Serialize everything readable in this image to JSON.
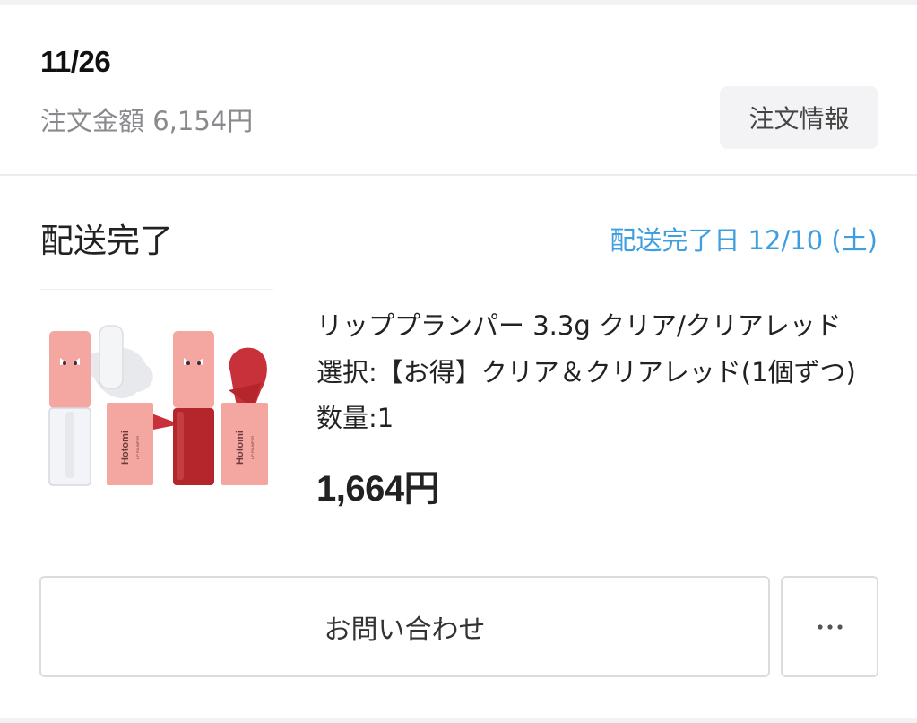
{
  "order": {
    "date": "11/26",
    "total_label": "注文金額 6,154円",
    "info_button_label": "注文情報"
  },
  "delivery": {
    "status": "配送完了",
    "completed_date": "配送完了日 12/10 (土)"
  },
  "item": {
    "name": "リッププランパー 3.3g クリア/クリアレッド",
    "option": "選択:【お得】クリア＆クリアレッド(1個ずつ)",
    "quantity": "数量:1",
    "price": "1,664円",
    "image": {
      "brand_text": "Hotomi",
      "sub_text": "LIP PLUMPER",
      "colors": {
        "cap": "#f4a7a0",
        "clear_liquid": "#f2f4f7",
        "red_liquid": "#b5262c"
      }
    }
  },
  "actions": {
    "contact_label": "お問い合わせ",
    "more_icon": "ellipsis-icon"
  },
  "colors": {
    "accent_blue": "#3d9ee0",
    "muted_text": "#8a8a8e",
    "button_bg": "#f3f3f5",
    "border": "#dcdcde"
  }
}
